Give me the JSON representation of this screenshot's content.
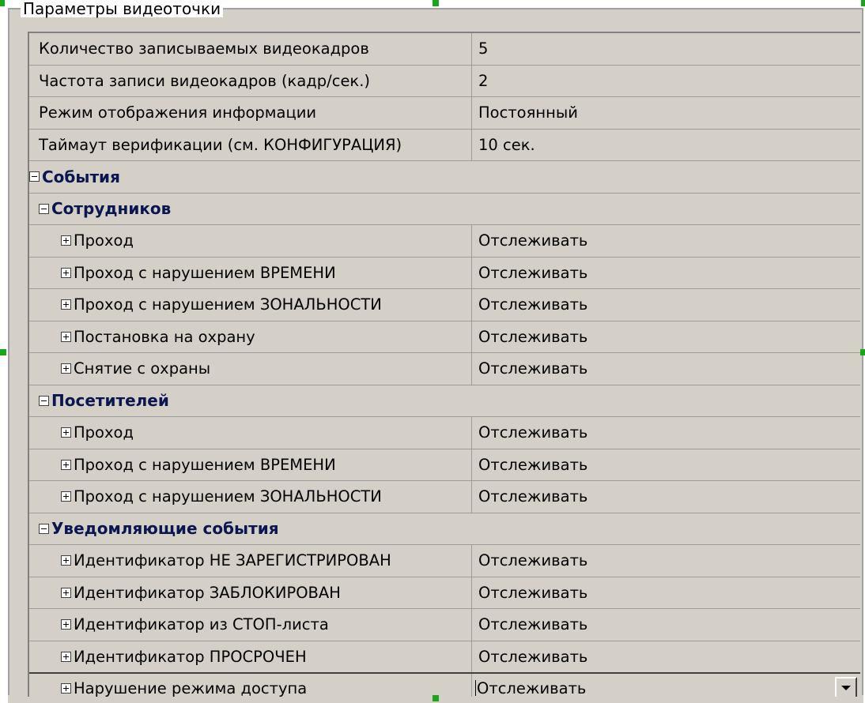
{
  "groupbox": {
    "title": "Параметры видеоточки"
  },
  "rows": [
    {
      "type": "prop",
      "level": 0,
      "name": "Количество записываемых видеокадров",
      "value": "5"
    },
    {
      "type": "prop",
      "level": 0,
      "name": "Частота записи видеокадров (кадр/сек.)",
      "value": "2"
    },
    {
      "type": "prop",
      "level": 0,
      "name": "Режим отображения информации",
      "value": "Постоянный"
    },
    {
      "type": "prop",
      "level": 0,
      "name": "Таймаут верификации (см. КОНФИГУРАЦИЯ)",
      "value": "10 сек."
    },
    {
      "type": "category",
      "level": 0,
      "name": "События",
      "expander": "minus"
    },
    {
      "type": "category",
      "level": 1,
      "name": "Сотрудников",
      "expander": "minus"
    },
    {
      "type": "prop",
      "level": 2,
      "name": "Проход",
      "value": "Отслеживать",
      "expander": "plus"
    },
    {
      "type": "prop",
      "level": 2,
      "name": "Проход с нарушением ВРЕМЕНИ",
      "value": "Отслеживать",
      "expander": "plus"
    },
    {
      "type": "prop",
      "level": 2,
      "name": "Проход с нарушением ЗОНАЛЬНОСТИ",
      "value": "Отслеживать",
      "expander": "plus"
    },
    {
      "type": "prop",
      "level": 2,
      "name": "Постановка на охрану",
      "value": "Отслеживать",
      "expander": "plus"
    },
    {
      "type": "prop",
      "level": 2,
      "name": "Снятие с охраны",
      "value": "Отслеживать",
      "expander": "plus"
    },
    {
      "type": "category",
      "level": 1,
      "name": "Посетителей",
      "expander": "minus"
    },
    {
      "type": "prop",
      "level": 2,
      "name": "Проход",
      "value": "Отслеживать",
      "expander": "plus"
    },
    {
      "type": "prop",
      "level": 2,
      "name": "Проход с нарушением ВРЕМЕНИ",
      "value": "Отслеживать",
      "expander": "plus"
    },
    {
      "type": "prop",
      "level": 2,
      "name": "Проход с нарушением ЗОНАЛЬНОСТИ",
      "value": "Отслеживать",
      "expander": "plus"
    },
    {
      "type": "category",
      "level": 1,
      "name": "Уведомляющие события",
      "expander": "minus"
    },
    {
      "type": "prop",
      "level": 2,
      "name": "Идентификатор НЕ ЗАРЕГИСТРИРОВАН",
      "value": "Отслеживать",
      "expander": "plus"
    },
    {
      "type": "prop",
      "level": 2,
      "name": "Идентификатор ЗАБЛОКИРОВАН",
      "value": "Отслеживать",
      "expander": "plus"
    },
    {
      "type": "prop",
      "level": 2,
      "name": "Идентификатор из СТОП-листа",
      "value": "Отслеживать",
      "expander": "plus"
    },
    {
      "type": "prop",
      "level": 2,
      "name": "Идентификатор ПРОСРОЧЕН",
      "value": "Отслеживать",
      "expander": "plus"
    },
    {
      "type": "prop",
      "level": 2,
      "name": "Нарушение режима доступа",
      "value": "Отслеживать",
      "expander": "plus",
      "selected": true,
      "dropdown": true
    }
  ],
  "icons": {
    "expand": "plus-box-icon",
    "collapse": "minus-box-icon",
    "dropdown": "chevron-down-icon"
  },
  "colors": {
    "grid_bg": "#d4d0c8",
    "category_text": "#0a1650",
    "handle": "#1aa51a"
  }
}
